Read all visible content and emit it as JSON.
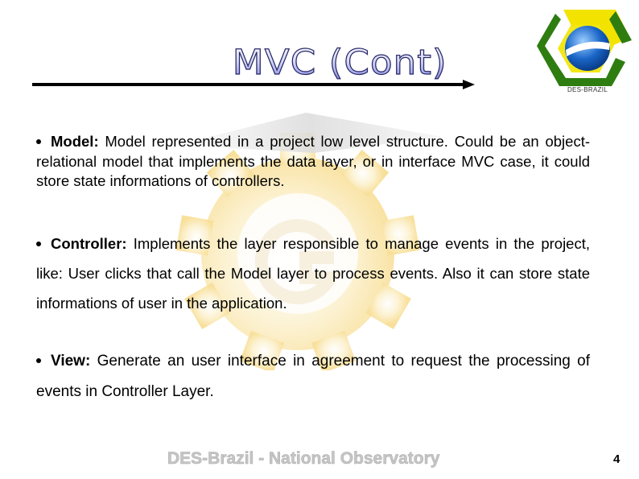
{
  "slide": {
    "title": "MVC (Cont)",
    "logo_caption": "DES-BRAZIL",
    "colors": {
      "title_outline": "#2a2a6a",
      "title_fill_bottom": "#7a80dc",
      "logo_green": "#2e7d10",
      "logo_yellow": "#f2e400",
      "logo_blue": "#1a66c8",
      "footer_text": "#c6c6c6",
      "watermark_gold": "#f3c23a"
    },
    "bullets": [
      {
        "term": "Model:",
        "text": "Model represented in a project low level structure.  Could be an object-relational model that implements the data layer, or in interface MVC case, it could store state informations of controllers."
      },
      {
        "term": "Controller:",
        "text": "Implements the layer responsible to manage events in the project, like: User clicks that call the Model layer to process events. Also it can store state informations of user in the application."
      },
      {
        "term": "View:",
        "text": "Generate an user interface in agreement to request the processing of events in Controller Layer."
      }
    ],
    "footer": "DES-Brazil - National Observatory",
    "page_number": "4"
  }
}
